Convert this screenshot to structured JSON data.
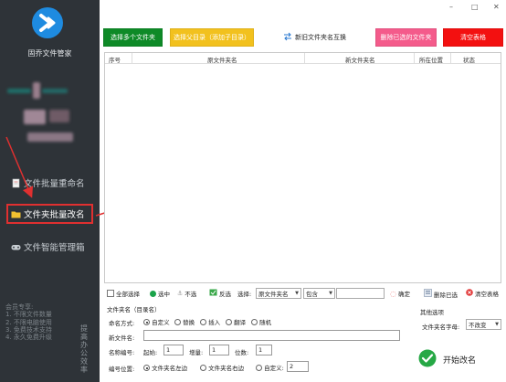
{
  "app": {
    "name": "固乔文件管家"
  },
  "window_controls": {
    "minimize": "–",
    "maximize": "□",
    "close": "✕"
  },
  "sidebar": {
    "nav": [
      {
        "label": "文件批量重命名",
        "icon": "file-icon"
      },
      {
        "label": "文件夹批量改名",
        "icon": "folder-icon",
        "active": true
      },
      {
        "label": "文件智能管理箱",
        "icon": "gamepad-icon"
      }
    ],
    "note_lines": [
      "会员专享:",
      "1. 不限文件数量",
      "2. 不限电脑使用",
      "3. 免费技术支持",
      "4. 永久免费升级"
    ],
    "vertical_text": "提高办公效率"
  },
  "toolbar": {
    "add_folders": "选择多个文件夹",
    "from_folder": "选择父目录（添加子目录）",
    "swap_names": "新旧文件夹名互换",
    "delete_selected": "删除已选的文件夹",
    "clear_list": "清空表格"
  },
  "table": {
    "columns": [
      "序号",
      "原文件夹名",
      "新文件夹名",
      "所在位置",
      "状态"
    ],
    "rows": []
  },
  "actionbar": {
    "select_all": "全部选择",
    "select": "选中",
    "deselect": "不选",
    "invert": "反选",
    "choose_label": "选择:",
    "field_option": "原文件夹名",
    "match_option": "包含",
    "filter_value": "",
    "confirm": "确定",
    "delete_selected": "删除已选",
    "clear_table": "清空表格"
  },
  "settings": {
    "section_title": "文件夹名（目录名）",
    "naming_label": "命名方式:",
    "naming_options": [
      "自定义",
      "替换",
      "插入",
      "翻译",
      "随机"
    ],
    "naming_selected": "自定义",
    "new_name_label": "新文件名:",
    "new_name_value": "",
    "numbering_label": "名称编号:",
    "start_label": "起始:",
    "start_value": "1",
    "increment_label": "增量:",
    "increment_value": "1",
    "digits_label": "位数:",
    "digits_value": "1",
    "position_label": "编号位置:",
    "position_options": [
      "文件夹名左边",
      "文件夹名右边",
      "自定义:"
    ],
    "position_selected": "文件夹名左边",
    "position_custom_value": "2"
  },
  "other": {
    "title": "其他选项",
    "case_label": "文件夹名字母:",
    "case_value": "不改变",
    "start_button": "开始改名"
  },
  "colors": {
    "sidebar_bg": "#2e3338",
    "green": "#0e8a27",
    "yellow": "#f2c11e",
    "pink": "#f45b8b",
    "red": "#f31010",
    "annotation_red": "#e03030"
  }
}
